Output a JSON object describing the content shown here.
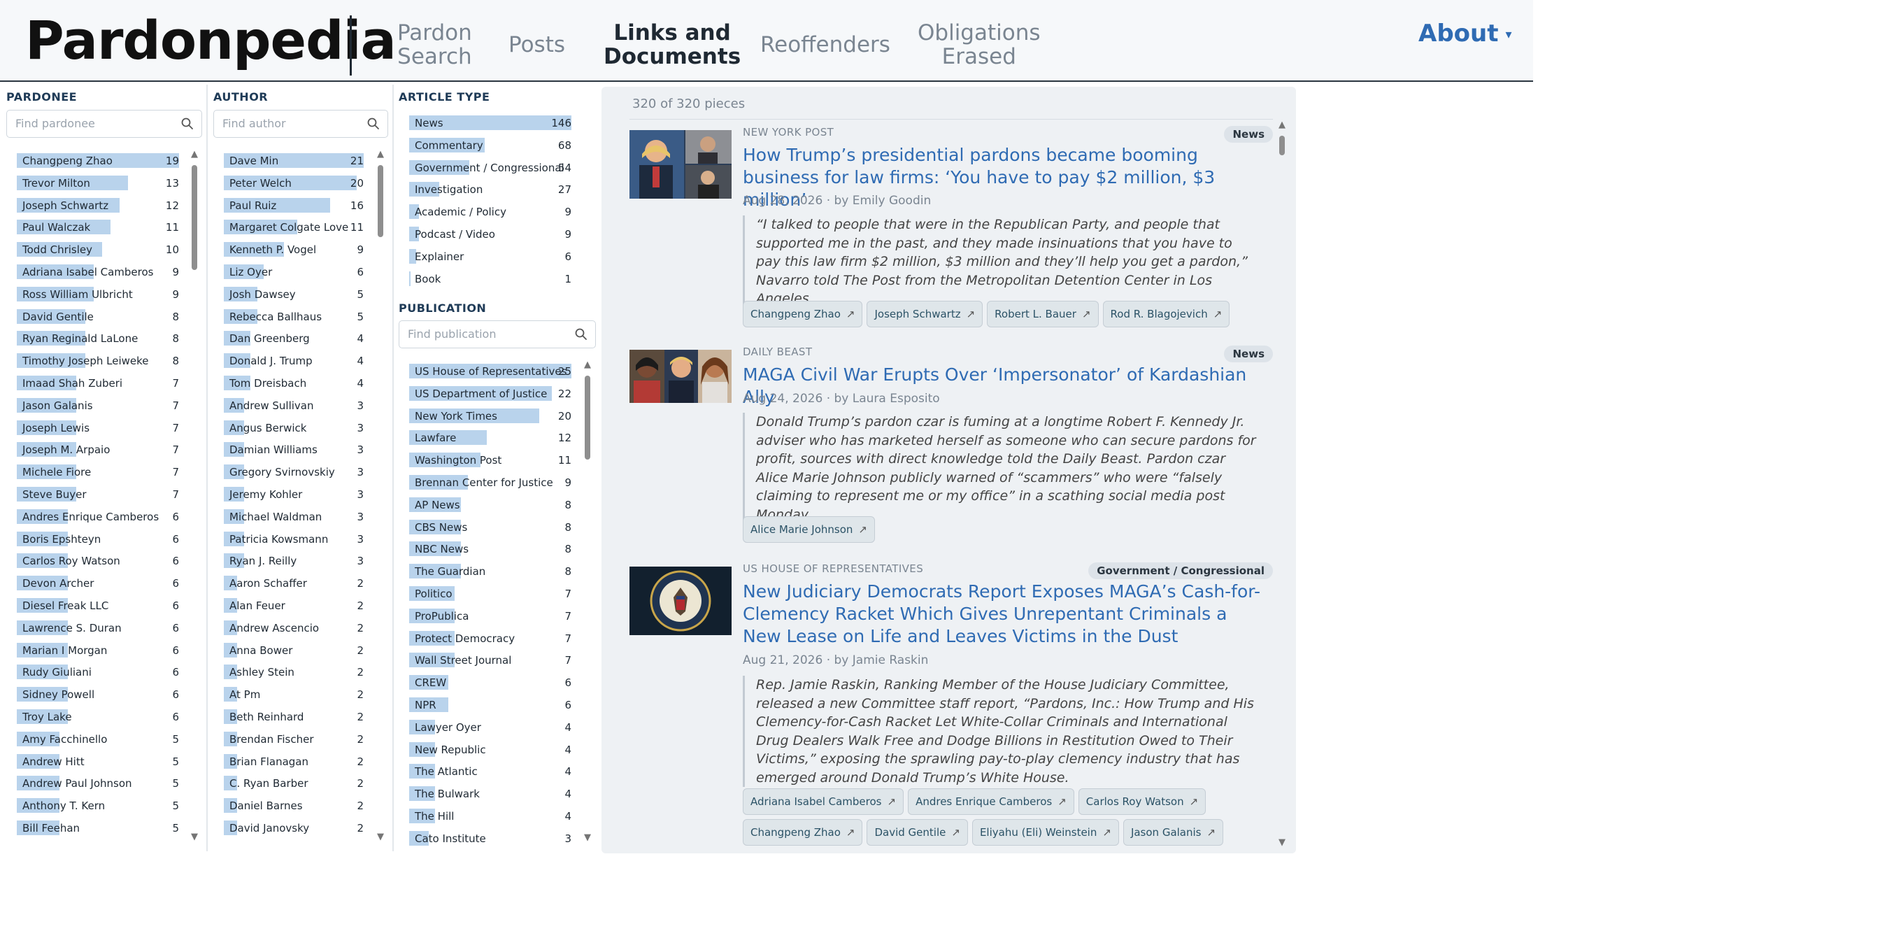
{
  "header": {
    "logo": "Pardonpedia",
    "nav": [
      {
        "line1": "Pardon",
        "line2": "Search"
      },
      {
        "line1": "Posts",
        "line2": ""
      },
      {
        "line1": "Links and",
        "line2": "Documents"
      },
      {
        "line1": "Reoffenders",
        "line2": ""
      },
      {
        "line1": "Obligations",
        "line2": "Erased"
      }
    ],
    "about": "About",
    "about_caret": "▾"
  },
  "facets": {
    "pardonee": {
      "title": "PARDONEE",
      "placeholder": "Find pardonee",
      "max": 19,
      "items": [
        {
          "label": "Changpeng Zhao",
          "count": 19
        },
        {
          "label": "Trevor Milton",
          "count": 13
        },
        {
          "label": "Joseph Schwartz",
          "count": 12
        },
        {
          "label": "Paul Walczak",
          "count": 11
        },
        {
          "label": "Todd Chrisley",
          "count": 10
        },
        {
          "label": "Adriana Isabel Camberos",
          "count": 9
        },
        {
          "label": "Ross William Ulbricht",
          "count": 9
        },
        {
          "label": "David Gentile",
          "count": 8
        },
        {
          "label": "Ryan Reginald LaLone",
          "count": 8
        },
        {
          "label": "Timothy Joseph Leiweke",
          "count": 8
        },
        {
          "label": "Imaad Shah Zuberi",
          "count": 7
        },
        {
          "label": "Jason Galanis",
          "count": 7
        },
        {
          "label": "Joseph Lewis",
          "count": 7
        },
        {
          "label": "Joseph M. Arpaio",
          "count": 7
        },
        {
          "label": "Michele Fiore",
          "count": 7
        },
        {
          "label": "Steve Buyer",
          "count": 7
        },
        {
          "label": "Andres Enrique Camberos",
          "count": 6
        },
        {
          "label": "Boris Epshteyn",
          "count": 6
        },
        {
          "label": "Carlos Roy Watson",
          "count": 6
        },
        {
          "label": "Devon Archer",
          "count": 6
        },
        {
          "label": "Diesel Freak LLC",
          "count": 6
        },
        {
          "label": "Lawrence S. Duran",
          "count": 6
        },
        {
          "label": "Marian I Morgan",
          "count": 6
        },
        {
          "label": "Rudy Giuliani",
          "count": 6
        },
        {
          "label": "Sidney Powell",
          "count": 6
        },
        {
          "label": "Troy Lake",
          "count": 6
        },
        {
          "label": "Amy Facchinello",
          "count": 5
        },
        {
          "label": "Andrew Hitt",
          "count": 5
        },
        {
          "label": "Andrew Paul Johnson",
          "count": 5
        },
        {
          "label": "Anthony T. Kern",
          "count": 5
        },
        {
          "label": "Bill Feehan",
          "count": 5
        }
      ]
    },
    "author": {
      "title": "AUTHOR",
      "placeholder": "Find author",
      "max": 21,
      "items": [
        {
          "label": "Dave Min",
          "count": 21
        },
        {
          "label": "Peter Welch",
          "count": 20
        },
        {
          "label": "Paul Ruiz",
          "count": 16
        },
        {
          "label": "Margaret Colgate Love",
          "count": 11
        },
        {
          "label": "Kenneth P. Vogel",
          "count": 9
        },
        {
          "label": "Liz Oyer",
          "count": 6
        },
        {
          "label": "Josh Dawsey",
          "count": 5
        },
        {
          "label": "Rebecca Ballhaus",
          "count": 5
        },
        {
          "label": "Dan Greenberg",
          "count": 4
        },
        {
          "label": "Donald J. Trump",
          "count": 4
        },
        {
          "label": "Tom Dreisbach",
          "count": 4
        },
        {
          "label": "Andrew Sullivan",
          "count": 3
        },
        {
          "label": "Angus Berwick",
          "count": 3
        },
        {
          "label": "Damian Williams",
          "count": 3
        },
        {
          "label": "Gregory Svirnovskiy",
          "count": 3
        },
        {
          "label": "Jeremy Kohler",
          "count": 3
        },
        {
          "label": "Michael Waldman",
          "count": 3
        },
        {
          "label": "Patricia Kowsmann",
          "count": 3
        },
        {
          "label": "Ryan J. Reilly",
          "count": 3
        },
        {
          "label": "Aaron Schaffer",
          "count": 2
        },
        {
          "label": "Alan Feuer",
          "count": 2
        },
        {
          "label": "Andrew Ascencio",
          "count": 2
        },
        {
          "label": "Anna Bower",
          "count": 2
        },
        {
          "label": "Ashley Stein",
          "count": 2
        },
        {
          "label": "At Pm",
          "count": 2
        },
        {
          "label": "Beth Reinhard",
          "count": 2
        },
        {
          "label": "Brendan Fischer",
          "count": 2
        },
        {
          "label": "Brian Flanagan",
          "count": 2
        },
        {
          "label": "C. Ryan Barber",
          "count": 2
        },
        {
          "label": "Daniel Barnes",
          "count": 2
        },
        {
          "label": "David Janovsky",
          "count": 2
        }
      ]
    },
    "article_type": {
      "title": "ARTICLE TYPE",
      "max": 146,
      "items": [
        {
          "label": "News",
          "count": 146
        },
        {
          "label": "Commentary",
          "count": 68
        },
        {
          "label": "Government / Congressional",
          "count": 54
        },
        {
          "label": "Investigation",
          "count": 27
        },
        {
          "label": "Academic / Policy",
          "count": 9
        },
        {
          "label": "Podcast / Video",
          "count": 9
        },
        {
          "label": "Explainer",
          "count": 6
        },
        {
          "label": "Book",
          "count": 1
        }
      ]
    },
    "publication": {
      "title": "PUBLICATION",
      "placeholder": "Find publication",
      "max": 25,
      "items": [
        {
          "label": "US House of Representatives",
          "count": 25
        },
        {
          "label": "US Department of Justice",
          "count": 22
        },
        {
          "label": "New York Times",
          "count": 20
        },
        {
          "label": "Lawfare",
          "count": 12
        },
        {
          "label": "Washington Post",
          "count": 11
        },
        {
          "label": "Brennan Center for Justice",
          "count": 9
        },
        {
          "label": "AP News",
          "count": 8
        },
        {
          "label": "CBS News",
          "count": 8
        },
        {
          "label": "NBC News",
          "count": 8
        },
        {
          "label": "The Guardian",
          "count": 8
        },
        {
          "label": "Politico",
          "count": 7
        },
        {
          "label": "ProPublica",
          "count": 7
        },
        {
          "label": "Protect Democracy",
          "count": 7
        },
        {
          "label": "Wall Street Journal",
          "count": 7
        },
        {
          "label": "CREW",
          "count": 6
        },
        {
          "label": "NPR",
          "count": 6
        },
        {
          "label": "Lawyer Oyer",
          "count": 4
        },
        {
          "label": "New Republic",
          "count": 4
        },
        {
          "label": "The Atlantic",
          "count": 4
        },
        {
          "label": "The Bulwark",
          "count": 4
        },
        {
          "label": "The Hill",
          "count": 4
        },
        {
          "label": "Cato Institute",
          "count": 3
        }
      ]
    }
  },
  "results": {
    "count_text": "320 of 320 pieces",
    "articles": [
      {
        "publication": "NEW YORK POST",
        "type": "News",
        "title": "How Trump’s presidential pardons became booming business for law firms: ‘You have to pay $2 million, $3 million’",
        "meta": "Aug 28, 2026 · by Emily Goodin",
        "quote": "“I talked to people that were in the Republican Party, and people that supported me in the past, and they made insinuations that you have to pay this law firm $2 million, $3 million and they’ll help you get a pardon,” Navarro told The Post from the Metropolitan Detention Center in Los Angeles.",
        "tags": [
          "Changpeng Zhao",
          "Joseph Schwartz",
          "Robert L. Bauer",
          "Rod R. Blagojevich"
        ]
      },
      {
        "publication": "DAILY BEAST",
        "type": "News",
        "title": "MAGA Civil War Erupts Over ‘Impersonator’ of Kardashian Ally",
        "meta": "Aug 24, 2026 · by Laura Esposito",
        "quote": "Donald Trump’s pardon czar is fuming at a longtime Robert F. Kennedy Jr. adviser who has marketed herself as someone who can secure pardons for profit, sources with direct knowledge told the Daily Beast. Pardon czar Alice Marie Johnson publicly warned of “scammers” who were “falsely claiming to represent me or my office” in a scathing social media post Monday.",
        "tags": [
          "Alice Marie Johnson"
        ]
      },
      {
        "publication": "US HOUSE OF REPRESENTATIVES",
        "type": "Government / Congressional",
        "title": "New Judiciary Democrats Report Exposes MAGA’s Cash-for-Clemency Racket Which Gives Unrepentant Criminals a New Lease on Life and Leaves Victims in the Dust",
        "meta": "Aug 21, 2026 · by Jamie Raskin",
        "quote": "Rep. Jamie Raskin, Ranking Member of the House Judiciary Committee, released a new Committee staff report, “Pardons, Inc.: How Trump and His Clemency-for-Cash Racket Let White-Collar Criminals and International Drug Dealers Walk Free and Dodge Billions in Restitution Owed to Their Victims,” exposing the sprawling pay-to-play clemency industry that has emerged around Donald Trump’s White House.",
        "tags": [
          "Adriana Isabel Camberos",
          "Andres Enrique Camberos",
          "Carlos Roy Watson",
          "Changpeng Zhao",
          "David Gentile",
          "Eliyahu (Eli) Weinstein",
          "Jason Galanis"
        ]
      }
    ]
  },
  "colors": {
    "accent": "#2f6bb3",
    "bar": "#b9d3ec",
    "panel": "#eef1f4",
    "tag_bg": "#dfe6ea"
  },
  "icons": {
    "search": "search-icon",
    "tag_link": "external-arrow-icon",
    "scroll_up": "scroll-up-arrow-icon",
    "scroll_down": "scroll-down-arrow-icon"
  }
}
